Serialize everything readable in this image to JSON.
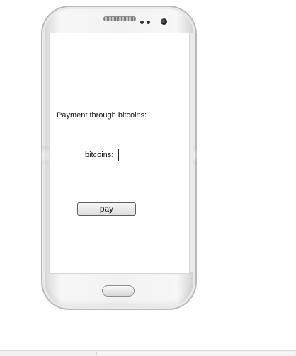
{
  "payment_form": {
    "title": "Payment through bitcoins:",
    "bitcoins_label": "bitcoins:",
    "bitcoins_value": "",
    "bitcoins_placeholder": "",
    "pay_label": "pay"
  },
  "icons": {
    "speaker": "speaker-grille-icon",
    "sensors": "sensor-dot-icon",
    "camera": "front-camera-icon",
    "home": "home-button-icon"
  }
}
